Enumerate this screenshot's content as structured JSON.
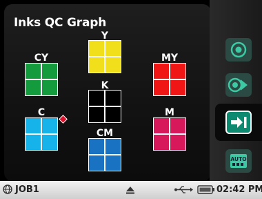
{
  "title": "Inks QC Graph",
  "swatches": [
    {
      "id": "Y",
      "label": "Y",
      "color": "#f2df1b"
    },
    {
      "id": "CY",
      "label": "CY",
      "color": "#139b3e"
    },
    {
      "id": "MY",
      "label": "MY",
      "color": "#f01616"
    },
    {
      "id": "K",
      "label": "K",
      "color": "#000000"
    },
    {
      "id": "C",
      "label": "C",
      "color": "#16b2ea"
    },
    {
      "id": "M",
      "label": "M",
      "color": "#d7185b"
    },
    {
      "id": "CM",
      "label": "CM",
      "color": "#1a73c2"
    }
  ],
  "selected_swatch": "C",
  "sidebar": {
    "buttons": [
      {
        "icon": "target-icon",
        "active": false
      },
      {
        "icon": "target-arrow-icon",
        "active": false
      },
      {
        "icon": "arrow-right-bar-icon",
        "active": true
      },
      {
        "icon": "auto-grid-icon",
        "label": "AUTO",
        "active": false
      }
    ]
  },
  "status": {
    "job": "JOB1",
    "time": "02:42 PM"
  },
  "colors": {
    "accent": "#0d8a70",
    "inactive_button": "#2a4a43"
  }
}
